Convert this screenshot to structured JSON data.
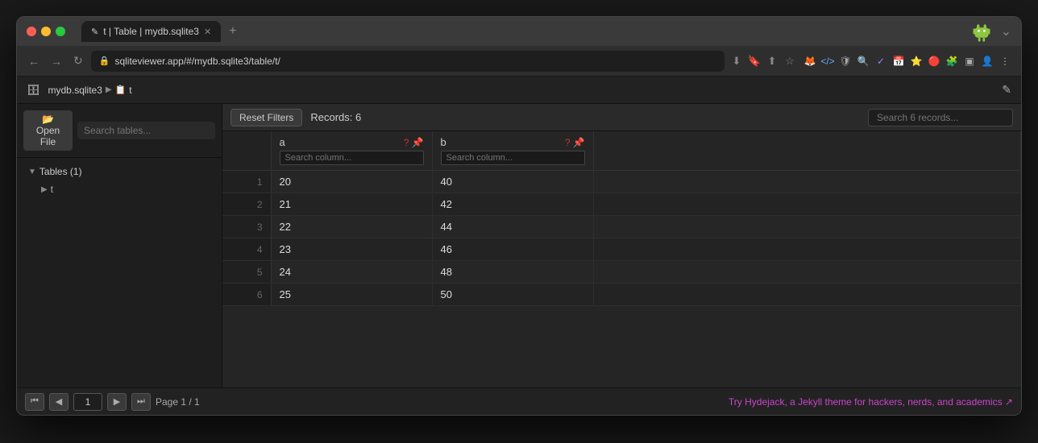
{
  "window": {
    "tab_label": "t | Table | mydb.sqlite3",
    "new_tab_tooltip": "New tab",
    "menu_btn": "⌄"
  },
  "toolbar": {
    "url": "sqliteviewer.app/#/mydb.sqlite3/table/t/",
    "back_tooltip": "Back",
    "forward_tooltip": "Forward",
    "reload_tooltip": "Reload"
  },
  "app_bar": {
    "logo": "📋",
    "breadcrumb_db": "mydb.sqlite3",
    "breadcrumb_sep": "▶",
    "breadcrumb_table": "t",
    "edit_icon": "✎"
  },
  "sidebar": {
    "open_file_label": "📂 Open File",
    "search_placeholder": "Search tables...",
    "tables_header": "Tables (1)",
    "table_name": "t"
  },
  "table_view": {
    "reset_filters_label": "Reset Filters",
    "records_count": "Records: 6",
    "search_placeholder": "Search 6 records...",
    "col_a_label": "a",
    "col_b_label": "b",
    "col_a_search_placeholder": "Search column...",
    "col_b_search_placeholder": "Search column...",
    "rows": [
      {
        "rownum": 1,
        "a": "20",
        "b": "40"
      },
      {
        "rownum": 2,
        "a": "21",
        "b": "42"
      },
      {
        "rownum": 3,
        "a": "22",
        "b": "44"
      },
      {
        "rownum": 4,
        "a": "23",
        "b": "46"
      },
      {
        "rownum": 5,
        "a": "24",
        "b": "48"
      },
      {
        "rownum": 6,
        "a": "25",
        "b": "50"
      }
    ]
  },
  "footer": {
    "page_input_value": "1",
    "page_info": "Page 1 / 1",
    "hydejack_text": "Try Hydejack, a Jekyll theme for hackers, nerds, and academics ↗"
  },
  "colors": {
    "accent_red": "#cc3333",
    "accent_purple": "#cc44cc"
  }
}
